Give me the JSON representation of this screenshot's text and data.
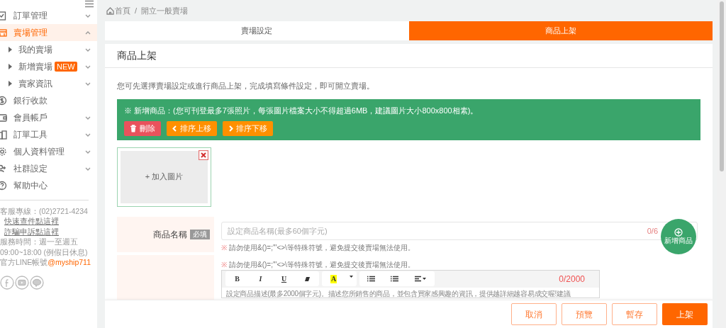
{
  "sidebar": {
    "items": [
      {
        "label": "訂單管理",
        "kind": "menu",
        "expanded": false,
        "selected": false
      },
      {
        "label": "賣場管理",
        "kind": "menu",
        "expanded": true,
        "selected": true,
        "children": [
          {
            "label": "我的賣場",
            "expanded": false
          },
          {
            "label": "新增賣場",
            "badge": "NEW",
            "expanded": false
          },
          {
            "label": "賣家資訊",
            "expanded": false
          }
        ]
      },
      {
        "label": "銀行收款",
        "kind": "link",
        "selected": false
      },
      {
        "label": "會員帳戶",
        "kind": "menu",
        "expanded": false,
        "selected": false
      },
      {
        "label": "訂單工具",
        "kind": "menu",
        "expanded": false,
        "selected": false
      },
      {
        "label": "個人資料管理",
        "kind": "menu",
        "expanded": false,
        "selected": false
      },
      {
        "label": "社群設定",
        "kind": "menu",
        "expanded": false,
        "selected": false
      },
      {
        "label": "幫助中心",
        "kind": "link",
        "selected": false
      }
    ],
    "contact": [
      {
        "kind": "text",
        "text": "客服專線：(02)2721-4234"
      },
      {
        "kind": "link",
        "text": "快速查件點這裡"
      },
      {
        "kind": "link",
        "text": "詐騙申訴點這裡"
      },
      {
        "kind": "text",
        "text": "服務時間：週一至週五"
      },
      {
        "kind": "text",
        "text": "09:00~18:00 (例假日休息)"
      },
      {
        "kind": "line",
        "text": "官方LINE帳號",
        "handle": "@myship711"
      }
    ]
  },
  "breadcrumb": [
    "首頁",
    "/",
    "開立一般賣場"
  ],
  "tabs": [
    {
      "label": "賣場設定",
      "selected": false
    },
    {
      "label": "商品上架",
      "selected": true
    }
  ],
  "card": {
    "title": "商品上架",
    "intro": "您可先選擇賣場設定或進行商品上架，完成填寫條件設定，即可開立賣場。",
    "banner": {
      "text": "※ 新增商品：(您可刊登最多7張照片，每張圖片檔案大小不得超過6MB，建議圖片大小800x800相素)。",
      "buttons": [
        {
          "kind": "delete",
          "label": "刪除"
        },
        {
          "kind": "up",
          "label": "排序上移"
        },
        {
          "kind": "down",
          "label": "排序下移"
        }
      ]
    },
    "image_slot": {
      "label": "+ 加入圖片"
    },
    "name_field": {
      "label": "商品名稱",
      "required_badge": "必填",
      "placeholder": "設定商品名稱(最多60個字元)",
      "counter": "0/6",
      "warning_mark": "※",
      "warning": "請勿使用&()=;'\"<>\\等特殊符號，避免提交後賣場無法使用。"
    },
    "description": {
      "warning_mark": "※",
      "warning": "請勿使用&()=;'\"<>\\等特殊符號，避免提交後賣場無法使用。",
      "toolbar": [
        {
          "kind": "bold",
          "label": "B"
        },
        {
          "kind": "italic",
          "label": "I"
        },
        {
          "kind": "underline",
          "label": "U"
        },
        {
          "kind": "eraser"
        },
        {
          "kind": "color",
          "label": "A"
        },
        {
          "kind": "caret"
        },
        {
          "kind": "ul"
        },
        {
          "kind": "ol"
        },
        {
          "kind": "align"
        }
      ],
      "counter": "0/2000",
      "placeholder": "設定商品描述(最多2000個字元)。描述您所銷售的商品，並包含買家感興趣的資訊，提供越詳細越容易成交喔!建議"
    }
  },
  "fab": {
    "label": "新增商品"
  },
  "actions": [
    {
      "label": "取消",
      "kind": "outline"
    },
    {
      "label": "預覽",
      "kind": "outline"
    },
    {
      "label": "暫存",
      "kind": "outline"
    },
    {
      "label": "上架",
      "kind": "primary"
    }
  ]
}
